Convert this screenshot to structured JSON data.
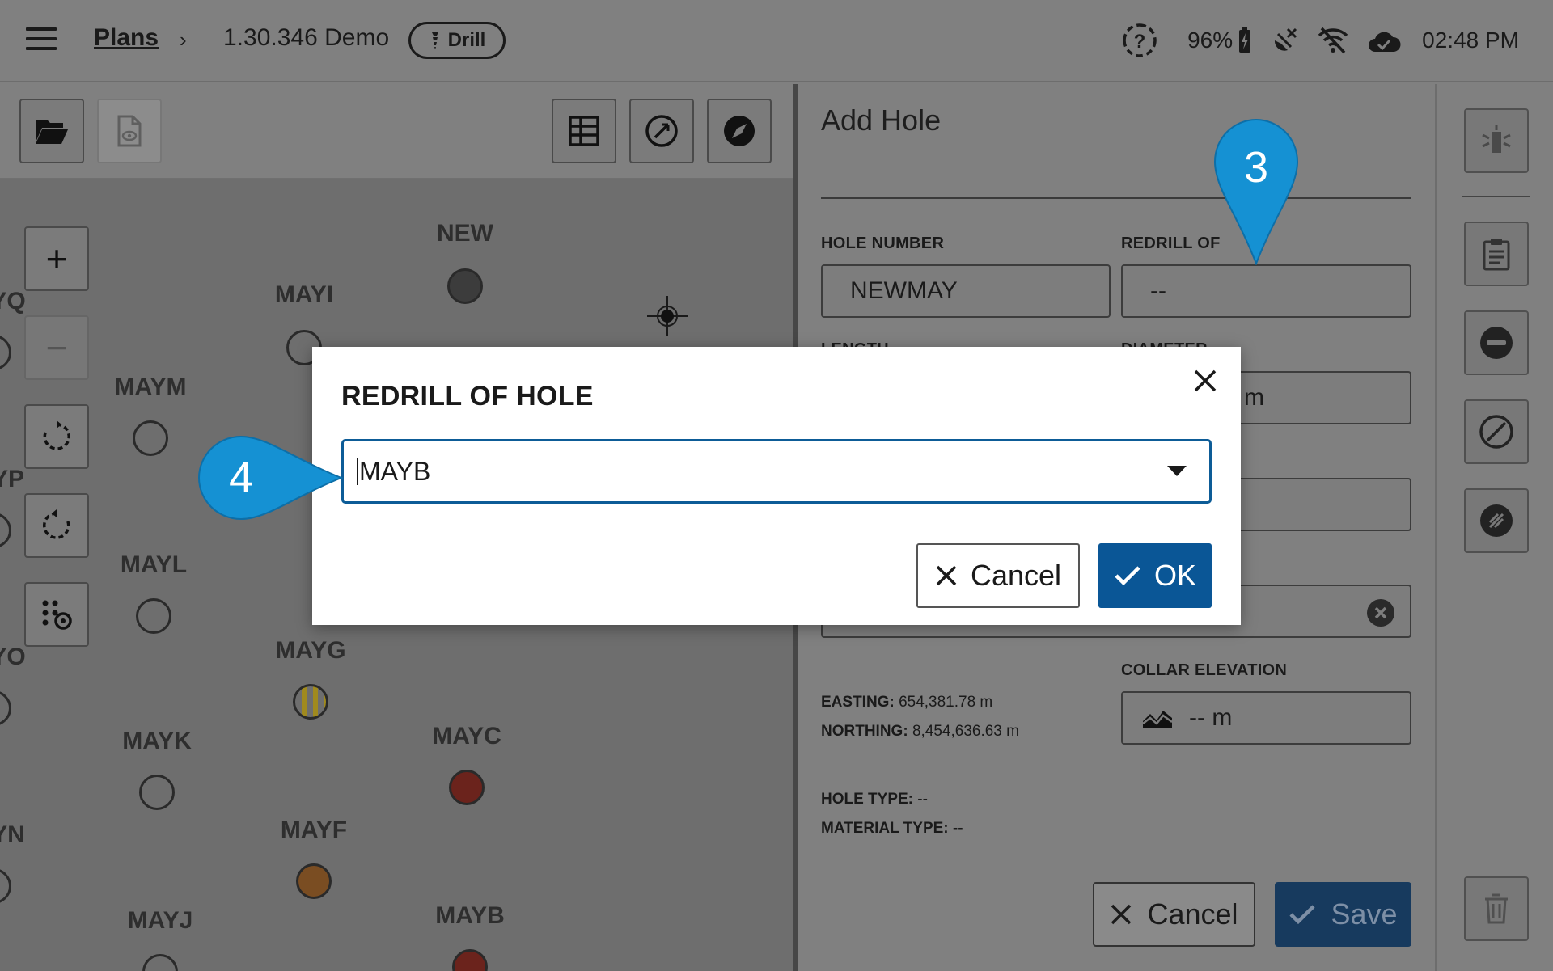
{
  "topbar": {
    "breadcrumb_root": "Plans",
    "breadcrumb_sep": "›",
    "plan_name": "1.30.346 Demo",
    "mode_badge": "Drill",
    "battery": "96%",
    "time": "02:48 PM"
  },
  "map": {
    "holes": [
      {
        "label": "NEW",
        "style": "dark-filled"
      },
      {
        "label": "MAYI",
        "style": "empty"
      },
      {
        "label": "MAYM",
        "style": "empty"
      },
      {
        "label": "MAYL",
        "style": "empty"
      },
      {
        "label": "MAYG",
        "style": "yellow-striped"
      },
      {
        "label": "MAYK",
        "style": "empty"
      },
      {
        "label": "MAYC",
        "style": "red-filled"
      },
      {
        "label": "MAYF",
        "style": "orange-marked"
      },
      {
        "label": "MAYJ",
        "style": "empty"
      },
      {
        "label": "MAYB",
        "style": "red-filled"
      },
      {
        "label": "YQ",
        "style": "edge"
      },
      {
        "label": "YP",
        "style": "edge"
      },
      {
        "label": "YO",
        "style": "edge"
      },
      {
        "label": "YN",
        "style": "edge"
      }
    ]
  },
  "panel": {
    "title": "Add Hole",
    "hole_number_label": "HOLE NUMBER",
    "hole_number_value": "NEWMAY",
    "redrill_label": "REDRILL OF",
    "redrill_value": "--",
    "length_label": "LENGTH",
    "diameter_label": "DIAMETER",
    "diameter_unit": "m",
    "collar_label": "COLLAR ELEVATION",
    "collar_value": "-- m",
    "easting_label": "EASTING:",
    "easting_value": "654,381.78 m",
    "northing_label": "NORTHING:",
    "northing_value": "8,454,636.63 m",
    "hole_type_label": "HOLE TYPE:",
    "hole_type_value": "--",
    "material_type_label": "MATERIAL TYPE:",
    "material_type_value": "--",
    "cancel_label": "Cancel",
    "save_label": "Save"
  },
  "modal": {
    "title": "REDRILL OF HOLE",
    "selected_value": "MAYB",
    "cancel_label": "Cancel",
    "ok_label": "OK"
  },
  "callouts": {
    "step3": "3",
    "step4": "4"
  },
  "colors": {
    "accent": "#0a5696",
    "callout": "#1591d3",
    "overlay_gray": "#808080",
    "red_hole": "#6b231c"
  }
}
